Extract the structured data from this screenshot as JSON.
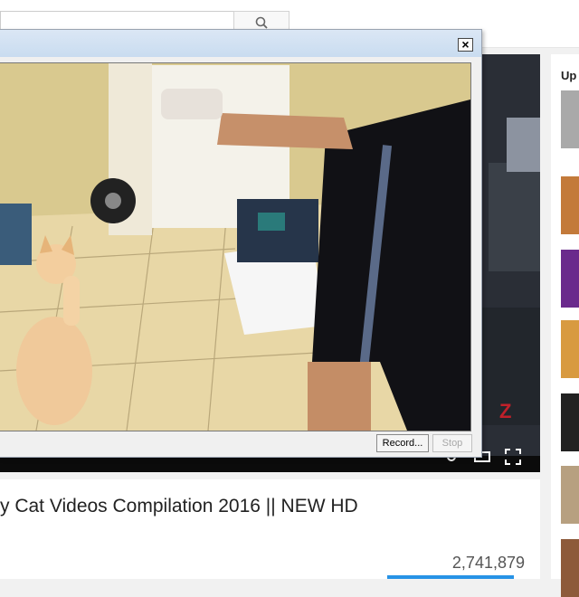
{
  "video": {
    "title": "y Cat Videos Compilation 2016 || NEW HD",
    "views": "2,741,879"
  },
  "sidebar": {
    "heading": "Up n"
  },
  "recorder": {
    "close_glyph": "×",
    "record_label": "Record...",
    "stop_label": "Stop"
  },
  "icons": {
    "search": "search-icon",
    "fullscreen": "fullscreen-icon",
    "settings": "settings-icon",
    "watermark": "Z"
  },
  "colors": {
    "accent": "#2793e6",
    "recorder_title": "#c9dcf0"
  }
}
